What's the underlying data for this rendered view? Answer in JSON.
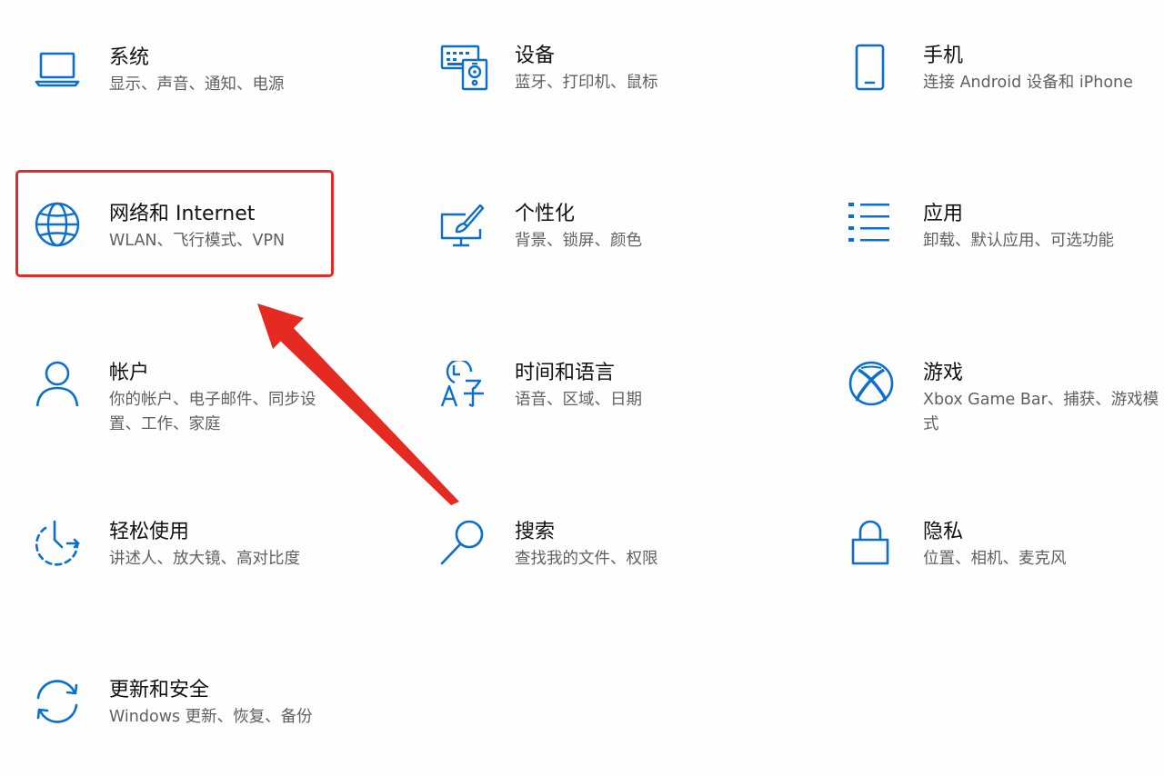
{
  "accent_color": "#0a6fcf",
  "annotation_color": "#e52a22",
  "tiles": [
    {
      "icon": "laptop-icon",
      "title": "系统",
      "desc": "显示、声音、通知、电源"
    },
    {
      "icon": "devices-icon",
      "title": "设备",
      "desc": "蓝牙、打印机、鼠标"
    },
    {
      "icon": "phone-icon",
      "title": "手机",
      "desc": "连接 Android 设备和 iPhone"
    },
    {
      "icon": "globe-icon",
      "title": "网络和 Internet",
      "desc": "WLAN、飞行模式、VPN"
    },
    {
      "icon": "personalization-icon",
      "title": "个性化",
      "desc": "背景、锁屏、颜色"
    },
    {
      "icon": "apps-list-icon",
      "title": "应用",
      "desc": "卸载、默认应用、可选功能"
    },
    {
      "icon": "person-icon",
      "title": "帐户",
      "desc": "你的帐户、电子邮件、同步设置、工作、家庭"
    },
    {
      "icon": "time-language-icon",
      "title": "时间和语言",
      "desc": "语音、区域、日期"
    },
    {
      "icon": "xbox-icon",
      "title": "游戏",
      "desc": "Xbox Game Bar、捕获、游戏模式"
    },
    {
      "icon": "ease-of-access-icon",
      "title": "轻松使用",
      "desc": "讲述人、放大镜、高对比度"
    },
    {
      "icon": "search-icon",
      "title": "搜索",
      "desc": "查找我的文件、权限"
    },
    {
      "icon": "lock-icon",
      "title": "隐私",
      "desc": "位置、相机、麦克风"
    },
    {
      "icon": "update-sync-icon",
      "title": "更新和安全",
      "desc": "Windows 更新、恢复、备份"
    }
  ]
}
